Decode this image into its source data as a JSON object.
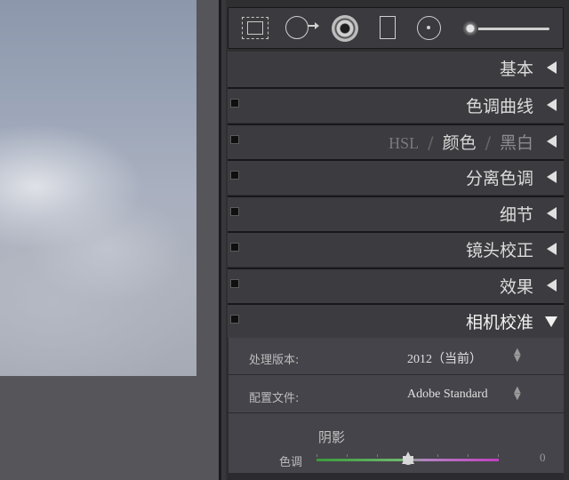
{
  "panels": [
    {
      "title": "基本",
      "has_toggle": false,
      "state": "collapsed"
    },
    {
      "title": "色调曲线",
      "has_toggle": true,
      "state": "collapsed"
    },
    {
      "title_parts": [
        "HSL",
        "/",
        "颜色",
        "/",
        "黑白"
      ],
      "has_toggle": true,
      "state": "collapsed"
    },
    {
      "title": "分离色调",
      "has_toggle": true,
      "state": "collapsed"
    },
    {
      "title": "细节",
      "has_toggle": true,
      "state": "collapsed"
    },
    {
      "title": "镜头校正",
      "has_toggle": true,
      "state": "collapsed"
    },
    {
      "title": "效果",
      "has_toggle": true,
      "state": "collapsed"
    },
    {
      "title": "相机校准",
      "has_toggle": true,
      "state": "expanded"
    }
  ],
  "tools": [
    "crop-overlay-icon",
    "spot-removal-icon",
    "red-eye-icon",
    "graduated-filter-icon",
    "radial-filter-icon",
    "adjustment-brush-icon"
  ],
  "calibration": {
    "process_label": "处理版本:",
    "process_value": "2012（当前）",
    "profile_label": "配置文件:",
    "profile_value": "Adobe Standard",
    "shadows_heading": "阴影",
    "tint_label": "色调",
    "tint_value": "0",
    "tint_level": 0.5
  },
  "colors": {
    "panel_bg": "#3c3b3f",
    "calibration_bg": "#45444a",
    "slider_green": "#3b9a3b",
    "slider_magenta": "#c040c0"
  }
}
